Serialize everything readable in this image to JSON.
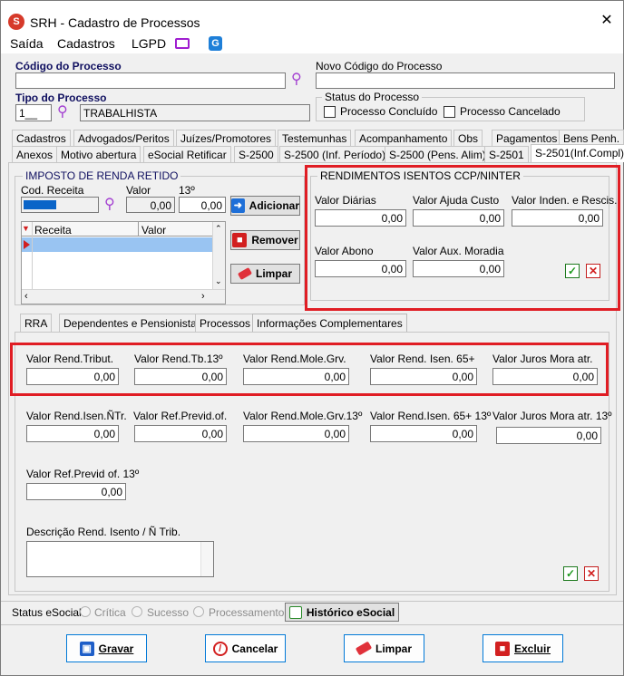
{
  "window": {
    "title": "SRH - Cadastro de Processos",
    "close_glyph": "✕"
  },
  "menu": [
    "Saída",
    "Cadastros",
    "LGPD"
  ],
  "header": {
    "codigo_label": "Código do Processo",
    "codigo_value": "",
    "novo_codigo_label": "Novo Código do Processo",
    "novo_codigo_value": "",
    "tipo_label": "Tipo do Processo",
    "tipo_code": "1__",
    "tipo_desc": "TRABALHISTA",
    "status_label": "Status do Processo",
    "status_concluido": "Processo Concluído",
    "status_cancelado": "Processo Cancelado"
  },
  "tabs_row1": [
    "Cadastros",
    "Advogados/Peritos",
    "Juízes/Promotores",
    "Testemunhas",
    "Acompanhamento",
    "Obs",
    "Pagamentos",
    "Bens Penh."
  ],
  "tabs_row2": [
    "Anexos",
    "Motivo abertura",
    "eSocial Retificar",
    "S-2500",
    "S-2500 (Inf. Período)",
    "S-2500 (Pens. Alim)",
    "S-2501",
    "S-2501(Inf.Compl)"
  ],
  "irrf": {
    "title": "IMPOSTO DE RENDA RETIDO",
    "cod_receita_label": "Cod. Receita",
    "valor_label": "Valor",
    "decimo_label": "13º",
    "valor_value": "0,00",
    "decimo_value": "0,00",
    "grid_col_receita": "Receita",
    "grid_col_valor": "Valor",
    "btn_adicionar": "Adicionar",
    "btn_remover": "Remover",
    "btn_limpar": "Limpar"
  },
  "ccp": {
    "title": "RENDIMENTOS ISENTOS CCP/NINTER",
    "fields": [
      {
        "label": "Valor Diárias",
        "value": "0,00"
      },
      {
        "label": "Valor Ajuda Custo",
        "value": "0,00"
      },
      {
        "label": "Valor Inden. e Rescis.",
        "value": "0,00"
      },
      {
        "label": "Valor Abono",
        "value": "0,00"
      },
      {
        "label": "Valor Aux. Moradia",
        "value": "0,00"
      }
    ]
  },
  "subtabs": [
    "RRA",
    "Dependentes e Pensionistas",
    "Processos",
    "Informações Complementares"
  ],
  "info_row1": [
    {
      "label": "Valor Rend.Tribut.",
      "value": "0,00"
    },
    {
      "label": "Valor Rend.Tb.13º",
      "value": "0,00"
    },
    {
      "label": "Valor Rend.Mole.Grv.",
      "value": "0,00"
    },
    {
      "label": "Valor Rend. Isen. 65+",
      "value": "0,00"
    },
    {
      "label": "Valor Juros Mora atr.",
      "value": "0,00"
    }
  ],
  "info_row2": [
    {
      "label": "Valor Rend.Isen.ÑTr.",
      "value": "0,00"
    },
    {
      "label": "Valor Ref.Previd.of.",
      "value": "0,00"
    },
    {
      "label": "Valor Rend.Mole.Grv.13º",
      "value": "0,00"
    },
    {
      "label": "Valor Rend.Isen. 65+ 13º",
      "value": "0,00"
    },
    {
      "label": "Valor Juros Mora atr. 13º",
      "value": "0,00"
    }
  ],
  "info_row3": {
    "label": "Valor Ref.Previd of. 13º",
    "value": "0,00"
  },
  "descricao_label": "Descrição Rend. Isento / Ñ Trib.",
  "status_esocial": {
    "label": "Status eSocial:",
    "options": [
      "Crítica",
      "Sucesso",
      "Processamento"
    ],
    "historico": "Histórico eSocial"
  },
  "footer": {
    "gravar": "Gravar",
    "cancelar": "Cancelar",
    "limpar": "Limpar",
    "excluir": "Excluir"
  }
}
